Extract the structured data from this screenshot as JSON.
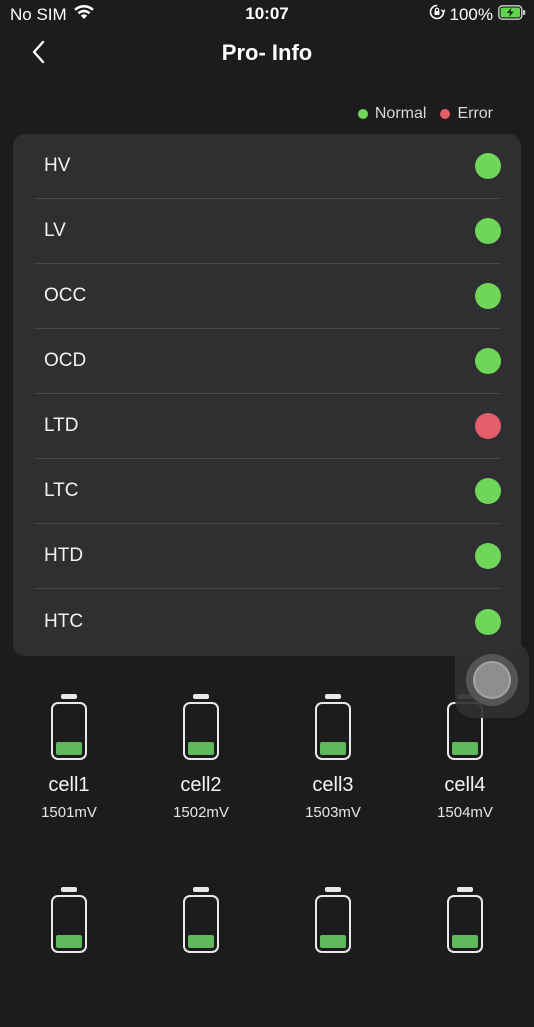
{
  "status_bar": {
    "carrier": "No SIM",
    "time": "10:07",
    "battery_percent": "100%",
    "icons": [
      "wifi-icon",
      "orientation-lock-icon",
      "battery-charging-icon"
    ]
  },
  "nav": {
    "back_icon": "chevron-left-icon",
    "title": "Pro- Info"
  },
  "legend": {
    "normal_label": "Normal",
    "error_label": "Error",
    "normal_color": "#6fd65a",
    "error_color": "#e35d6a"
  },
  "protections": [
    {
      "label": "HV",
      "status": "normal"
    },
    {
      "label": "LV",
      "status": "normal"
    },
    {
      "label": "OCC",
      "status": "normal"
    },
    {
      "label": "OCD",
      "status": "normal"
    },
    {
      "label": "LTD",
      "status": "error"
    },
    {
      "label": "LTC",
      "status": "normal"
    },
    {
      "label": "HTD",
      "status": "normal"
    },
    {
      "label": "HTC",
      "status": "normal"
    }
  ],
  "cells": [
    {
      "name": "cell1",
      "value": "1501mV",
      "level": 0.25
    },
    {
      "name": "cell2",
      "value": "1502mV",
      "level": 0.25
    },
    {
      "name": "cell3",
      "value": "1503mV",
      "level": 0.25
    },
    {
      "name": "cell4",
      "value": "1504mV",
      "level": 0.25
    },
    {
      "name": "",
      "value": "",
      "level": 0.25
    },
    {
      "name": "",
      "value": "",
      "level": 0.25
    },
    {
      "name": "",
      "value": "",
      "level": 0.25
    },
    {
      "name": "",
      "value": "",
      "level": 0.25
    }
  ],
  "colors": {
    "background": "#1c1c1e",
    "card": "#2f2f31",
    "battery_fill": "#5fb85c"
  },
  "floating_button_icon": "assistive-touch-icon"
}
